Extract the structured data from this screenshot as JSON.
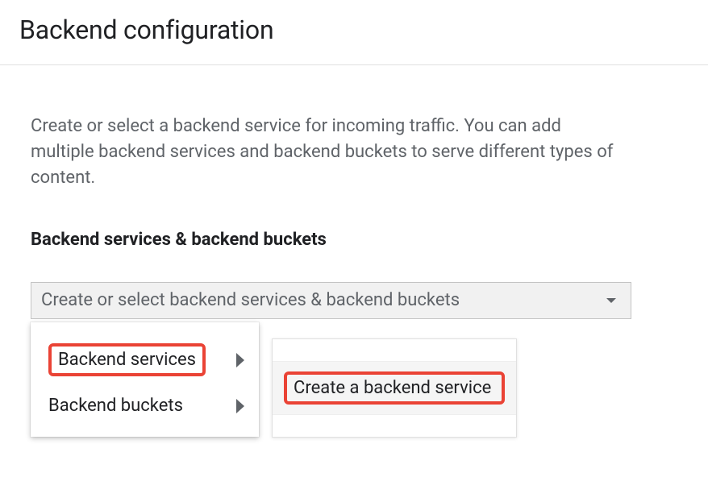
{
  "header": {
    "title": "Backend configuration"
  },
  "content": {
    "description": "Create or select a backend service for incoming traffic. You can add multiple backend services and backend buckets to serve different types of content.",
    "section_label": "Backend services & backend buckets"
  },
  "dropdown": {
    "placeholder": "Create or select backend services & backend buckets"
  },
  "menu": {
    "items": [
      {
        "label": "Backend services"
      },
      {
        "label": "Backend buckets"
      }
    ]
  },
  "submenu": {
    "item_label": "Create a backend service"
  }
}
